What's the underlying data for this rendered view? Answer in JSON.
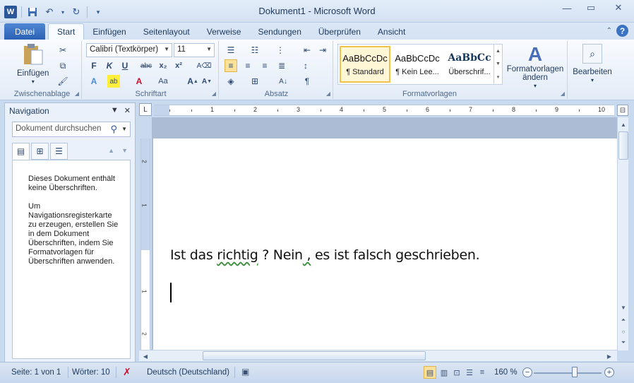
{
  "window": {
    "title": "Dokument1 - Microsoft Word"
  },
  "qat": {
    "app_icon": "word-icon",
    "save_icon": "save-icon",
    "undo_icon": "undo-icon",
    "redo_icon": "redo-icon",
    "customize_icon": "customize-qat-icon"
  },
  "tabs": {
    "file": "Datei",
    "items": [
      "Start",
      "Einfügen",
      "Seitenlayout",
      "Verweise",
      "Sendungen",
      "Überprüfen",
      "Ansicht"
    ],
    "active": "Start"
  },
  "ribbon": {
    "clipboard": {
      "label": "Zwischenablage",
      "paste": "Einfügen"
    },
    "font": {
      "label": "Schriftart",
      "font_name": "Calibri (Textkörper)",
      "font_size": "11"
    },
    "paragraph": {
      "label": "Absatz"
    },
    "styles": {
      "label": "Formatvorlagen",
      "items": [
        {
          "sample": "AaBbCcDc",
          "name": "¶ Standard"
        },
        {
          "sample": "AaBbCcDc",
          "name": "¶ Kein Lee..."
        },
        {
          "sample": "AaBbCc",
          "name": "Überschrif..."
        }
      ],
      "change_styles": "Formatvorlagen ändern"
    },
    "editing": {
      "label": "Bearbeiten"
    }
  },
  "navigation": {
    "title": "Navigation",
    "search_placeholder": "Dokument durchsuchen",
    "message1": "Dieses Dokument enthält keine Überschriften.",
    "message2": "Um Navigationsregisterkarte zu erzeugen, erstellen Sie in dem Dokument Überschriften, indem Sie Formatvorlagen für Überschriften anwenden."
  },
  "document": {
    "text_before": "Ist das ",
    "text_squiggle1": "richtig",
    "text_mid": " ? Nein",
    "text_squiggle2": " ,",
    "text_after": " es ist falsch geschrieben."
  },
  "statusbar": {
    "page": "Seite: 1 von 1",
    "words": "Wörter: 10",
    "language": "Deutsch (Deutschland)",
    "zoom": "160 %"
  }
}
